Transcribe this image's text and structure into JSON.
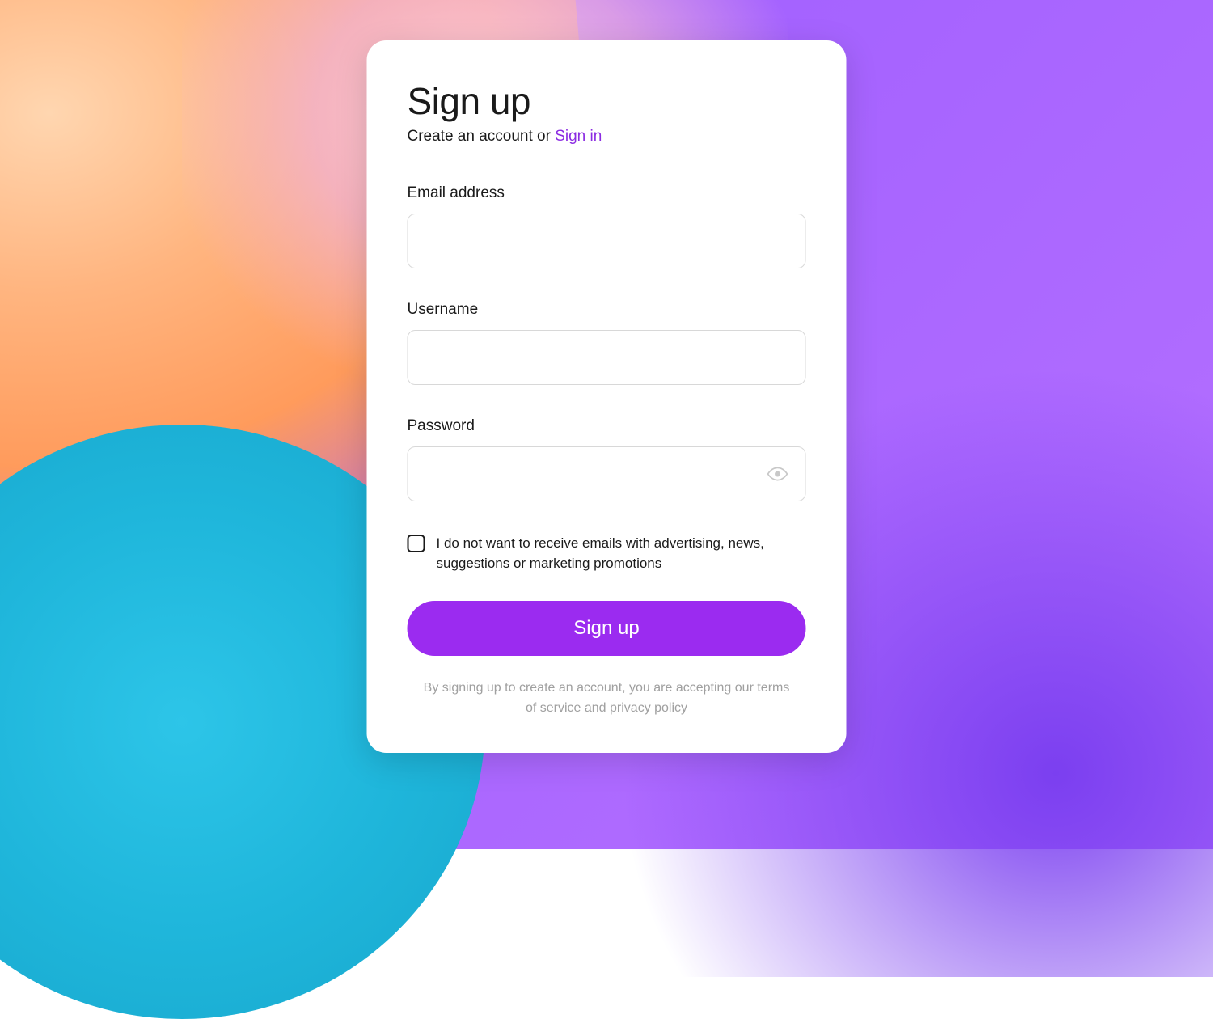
{
  "header": {
    "title": "Sign up",
    "subtitle_prefix": "Create an account or ",
    "signin_link": "Sign in"
  },
  "fields": {
    "email": {
      "label": "Email address",
      "value": "",
      "placeholder": ""
    },
    "username": {
      "label": "Username",
      "value": "",
      "placeholder": ""
    },
    "password": {
      "label": "Password",
      "value": "",
      "placeholder": ""
    }
  },
  "optout": {
    "checked": false,
    "label": "I do not want to receive emails with advertising, news, suggestions or marketing promotions"
  },
  "submit": {
    "label": "Sign up"
  },
  "terms": {
    "text": "By signing up to create an account, you are accepting our terms of service and privacy policy"
  },
  "colors": {
    "accent": "#9b2bf0",
    "link": "#8b2be2"
  }
}
